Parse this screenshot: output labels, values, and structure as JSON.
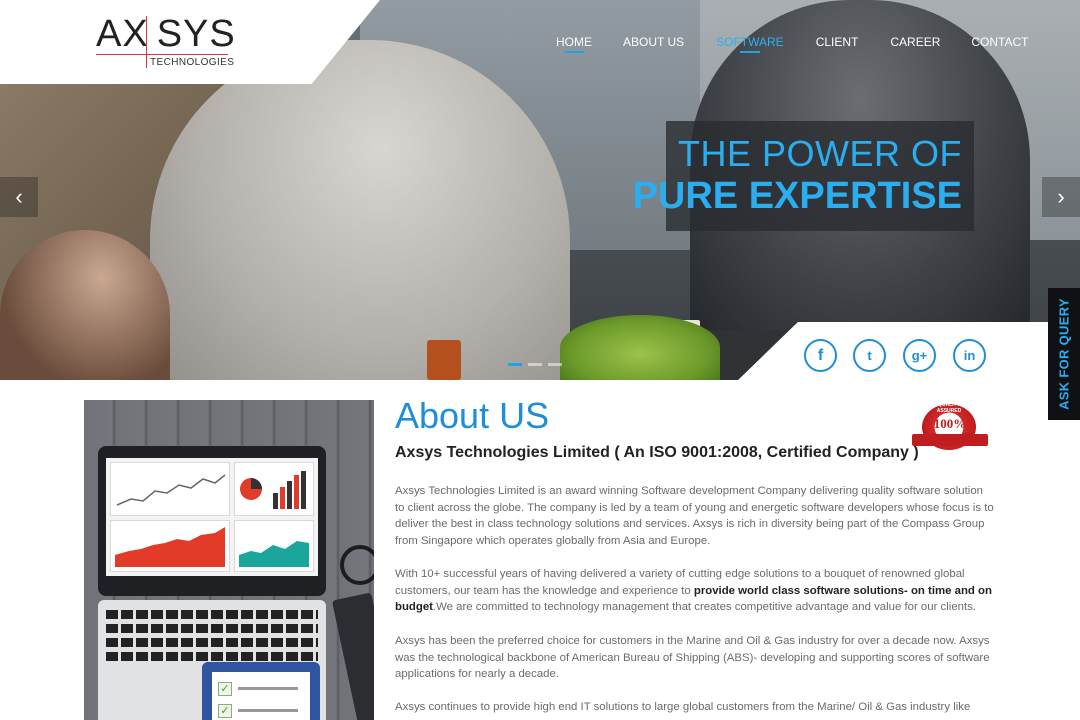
{
  "brand": {
    "logo_main": "AX|SYS",
    "logo_sub": "TECHNOLOGIES"
  },
  "nav": {
    "items": [
      {
        "label": "HOME",
        "state": "active"
      },
      {
        "label": "ABOUT US",
        "state": "normal"
      },
      {
        "label": "SOFTWARE",
        "state": "highlighted"
      },
      {
        "label": "CLIENT",
        "state": "normal"
      },
      {
        "label": "CAREER",
        "state": "normal"
      },
      {
        "label": "CONTACT",
        "state": "normal"
      }
    ]
  },
  "hero": {
    "caption_line1": "THE POWER OF",
    "caption_line2": "PURE EXPERTISE",
    "prev_icon": "chevron-left-icon",
    "next_icon": "chevron-right-icon",
    "slides": 3,
    "active_slide": 1
  },
  "social": [
    {
      "name": "facebook-icon",
      "glyph": "f"
    },
    {
      "name": "twitter-icon",
      "glyph": "t"
    },
    {
      "name": "google-plus-icon",
      "glyph": "g+"
    },
    {
      "name": "linkedin-icon",
      "glyph": "in"
    }
  ],
  "query_tab": {
    "label": "ASK FOR QUERY"
  },
  "about": {
    "title": "About US",
    "subtitle": "Axsys Technologies Limited ( An ISO 9001:2008, Certified Company )",
    "badge_number": "100%",
    "badge_top": "QUALITY ASSURED",
    "badge_ribbon": "ISO 9001:2008 CERTIFIED",
    "p1": "Axsys Technologies Limited is an award winning Software development Company delivering quality software solution to client across the globe. The company is led by a team of young and energetic software developers whose focus is to deliver the best in class technology solutions and services. Axsys is rich in diversity being part of the Compass Group from Singapore which operates globally from Asia and Europe.",
    "p2_before": "With 10+ successful years of having delivered a variety of cutting edge solutions to a bouquet of renowned global customers, our team has the knowledge and experience to ",
    "p2_bold": "provide world class software solutions- on time and on budget",
    "p2_after": ".We are committed to technology management that creates competitive advantage and value for our clients.",
    "p3": "Axsys has been the preferred choice for customers in the Marine and Oil & Gas industry for over a decade now. Axsys was the technological backbone of American Bureau of Shipping (ABS)- developing and supporting scores of software applications for nearly a decade.",
    "p4": "Axsys continues to provide high end IT solutions to large global customers from the Marine/ Oil & Gas industry like"
  },
  "colors": {
    "accent": "#1e8fd6",
    "caption": "#2aaef0",
    "badge": "#c01e1e"
  }
}
